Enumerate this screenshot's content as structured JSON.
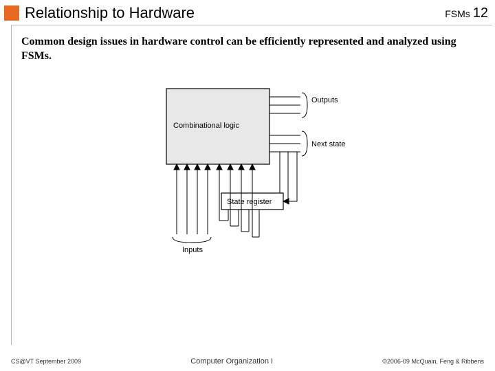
{
  "header": {
    "title": "Relationship to Hardware",
    "tag": "FSMs",
    "page": "12"
  },
  "body": {
    "text": "Common design issues in hardware control can be efficiently represented and analyzed using FSMs."
  },
  "diagram": {
    "block_comb": "Combinational logic",
    "block_state": "State register",
    "label_outputs": "Outputs",
    "label_next_state": "Next state",
    "label_inputs": "Inputs"
  },
  "footer": {
    "left": "CS@VT September 2009",
    "center": "Computer Organization I",
    "right": "©2006-09  McQuain, Feng & Ribbens"
  }
}
